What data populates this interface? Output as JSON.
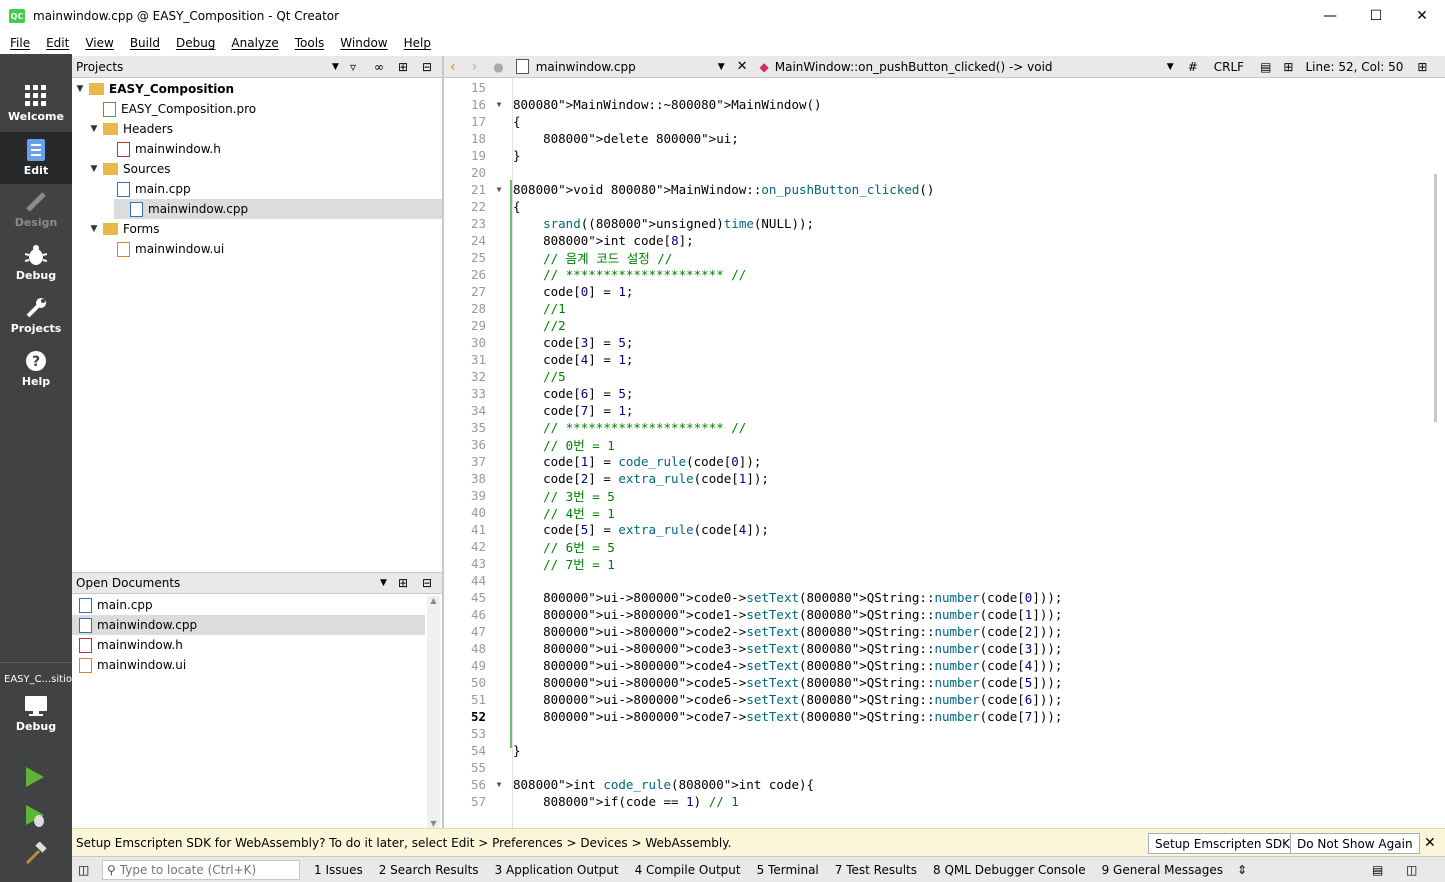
{
  "window": {
    "title": "mainwindow.cpp @ EASY_Composition - Qt Creator",
    "app_icon": "QC"
  },
  "menu": [
    "File",
    "Edit",
    "View",
    "Build",
    "Debug",
    "Analyze",
    "Tools",
    "Window",
    "Help"
  ],
  "modes": {
    "welcome": "Welcome",
    "edit": "Edit",
    "design": "Design",
    "debug": "Debug",
    "projects": "Projects",
    "help": "Help",
    "kit_name": "EASY_C...sition",
    "kit_mode": "Debug"
  },
  "projects_panel": {
    "title": "Projects"
  },
  "tree": [
    {
      "label": "EASY_Composition",
      "arrow": "▼",
      "bold": true
    },
    {
      "label": "EASY_Composition.pro",
      "arrow": ""
    },
    {
      "label": "Headers",
      "arrow": "▼"
    },
    {
      "label": "mainwindow.h",
      "arrow": ""
    },
    {
      "label": "Sources",
      "arrow": "▼"
    },
    {
      "label": "main.cpp",
      "arrow": ""
    },
    {
      "label": "mainwindow.cpp",
      "arrow": "",
      "selected": true
    },
    {
      "label": "Forms",
      "arrow": "▼"
    },
    {
      "label": "mainwindow.ui",
      "arrow": ""
    }
  ],
  "open_documents": {
    "title": "Open Documents",
    "items": [
      "main.cpp",
      "mainwindow.cpp",
      "mainwindow.h",
      "mainwindow.ui"
    ]
  },
  "editor_toolbar": {
    "file": "mainwindow.cpp",
    "symbol": "MainWindow::on_pushButton_clicked() -> void",
    "hash": "#",
    "line_ending": "CRLF",
    "position": "Line: 52, Col: 50"
  },
  "code": {
    "current_line": 52,
    "lines": [
      {
        "n": 15,
        "t": ""
      },
      {
        "n": 16,
        "t": "MainWindow::~MainWindow()",
        "fold": "▼"
      },
      {
        "n": 17,
        "t": "{"
      },
      {
        "n": 18,
        "t": "    delete ui;"
      },
      {
        "n": 19,
        "t": "}"
      },
      {
        "n": 20,
        "t": ""
      },
      {
        "n": 21,
        "t": "void MainWindow::on_pushButton_clicked()",
        "fold": "▼"
      },
      {
        "n": 22,
        "t": "{"
      },
      {
        "n": 23,
        "t": "    srand((unsigned)time(NULL));"
      },
      {
        "n": 24,
        "t": "    int code[8];"
      },
      {
        "n": 25,
        "t": "    // 음계 코드 설정 //"
      },
      {
        "n": 26,
        "t": "    // ********************* //"
      },
      {
        "n": 27,
        "t": "    code[0] = 1;"
      },
      {
        "n": 28,
        "t": "    //1"
      },
      {
        "n": 29,
        "t": "    //2"
      },
      {
        "n": 30,
        "t": "    code[3] = 5;"
      },
      {
        "n": 31,
        "t": "    code[4] = 1;"
      },
      {
        "n": 32,
        "t": "    //5"
      },
      {
        "n": 33,
        "t": "    code[6] = 5;"
      },
      {
        "n": 34,
        "t": "    code[7] = 1;"
      },
      {
        "n": 35,
        "t": "    // ********************* //"
      },
      {
        "n": 36,
        "t": "    // 0번 = 1"
      },
      {
        "n": 37,
        "t": "    code[1] = code_rule(code[0]);"
      },
      {
        "n": 38,
        "t": "    code[2] = extra_rule(code[1]);"
      },
      {
        "n": 39,
        "t": "    // 3번 = 5"
      },
      {
        "n": 40,
        "t": "    // 4번 = 1"
      },
      {
        "n": 41,
        "t": "    code[5] = extra_rule(code[4]);"
      },
      {
        "n": 42,
        "t": "    // 6번 = 5"
      },
      {
        "n": 43,
        "t": "    // 7번 = 1"
      },
      {
        "n": 44,
        "t": ""
      },
      {
        "n": 45,
        "t": "    ui->code0->setText(QString::number(code[0]));"
      },
      {
        "n": 46,
        "t": "    ui->code1->setText(QString::number(code[1]));"
      },
      {
        "n": 47,
        "t": "    ui->code2->setText(QString::number(code[2]));"
      },
      {
        "n": 48,
        "t": "    ui->code3->setText(QString::number(code[3]));"
      },
      {
        "n": 49,
        "t": "    ui->code4->setText(QString::number(code[4]));"
      },
      {
        "n": 50,
        "t": "    ui->code5->setText(QString::number(code[5]));"
      },
      {
        "n": 51,
        "t": "    ui->code6->setText(QString::number(code[6]));"
      },
      {
        "n": 52,
        "t": "    ui->code7->setText(QString::number(code[7]));"
      },
      {
        "n": 53,
        "t": ""
      },
      {
        "n": 54,
        "t": "}"
      },
      {
        "n": 55,
        "t": ""
      },
      {
        "n": 56,
        "t": "int code_rule(int code){",
        "fold": "▼"
      },
      {
        "n": 57,
        "t": "    if(code == 1) // 1"
      }
    ]
  },
  "infobar": {
    "message": "Setup Emscripten SDK for WebAssembly? To do it later, select Edit > Preferences > Devices > WebAssembly.",
    "setup_button": "Setup Emscripten SDK",
    "dismiss_button": "Do Not Show Again"
  },
  "statusbar": {
    "locator_placeholder": "Type to locate (Ctrl+K)",
    "panes": [
      "1  Issues",
      "2  Search Results",
      "3  Application Output",
      "4  Compile Output",
      "5  Terminal",
      "7  Test Results",
      "8  QML Debugger Console",
      "9  General Messages"
    ]
  }
}
